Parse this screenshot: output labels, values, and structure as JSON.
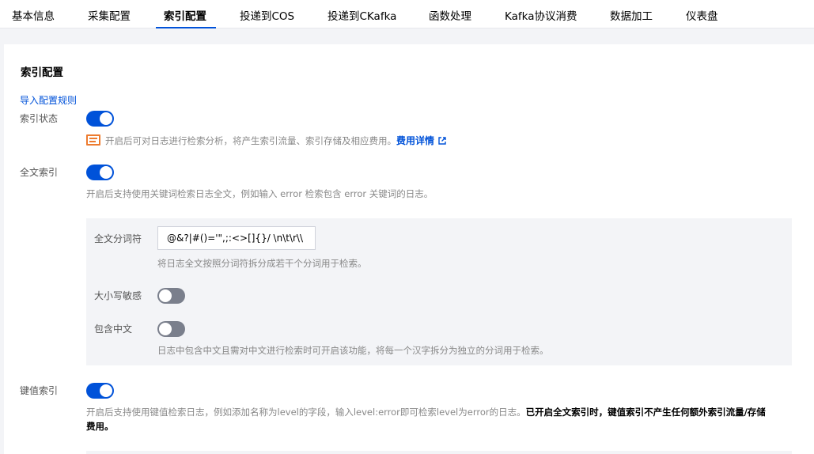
{
  "tabs": [
    {
      "label": "基本信息",
      "active": false
    },
    {
      "label": "采集配置",
      "active": false
    },
    {
      "label": "索引配置",
      "active": true
    },
    {
      "label": "投递到COS",
      "active": false
    },
    {
      "label": "投递到CKafka",
      "active": false
    },
    {
      "label": "函数处理",
      "active": false
    },
    {
      "label": "Kafka协议消费",
      "active": false
    },
    {
      "label": "数据加工",
      "active": false
    },
    {
      "label": "仪表盘",
      "active": false
    }
  ],
  "page": {
    "title": "索引配置",
    "import_rules_link": "导入配置规则"
  },
  "index_status": {
    "label": "索引状态",
    "enabled": true,
    "desc": "开启后可对日志进行检索分析，将产生索引流量、索引存储及相应费用。",
    "fee_link": "费用详情"
  },
  "fulltext_index": {
    "label": "全文索引",
    "enabled": true,
    "desc": "开启后支持使用关键词检索日志全文，例如输入 error 检索包含 error 关键词的日志。",
    "tokenizer": {
      "label": "全文分词符",
      "value": "@&?|#()='\",;:<>[]{}/ \\n\\t\\r\\\\",
      "desc": "将日志全文按照分词符拆分成若干个分词用于检索。"
    },
    "case_sensitive": {
      "label": "大小写敏感",
      "enabled": false
    },
    "include_chinese": {
      "label": "包含中文",
      "enabled": false,
      "desc": "日志中包含中文且需对中文进行检索时可开启该功能，将每一个汉字拆分为独立的分词用于检索。"
    }
  },
  "kv_index": {
    "label": "键值索引",
    "enabled": true,
    "desc": "开启后支持使用键值检索日志，例如添加名称为level的字段，输入level:error即可检索level为error的日志。",
    "desc_strong_line1": "已开启全文索引时，键值索引不产生任何额外索引流量/存储",
    "desc_strong_line2": "费用。"
  },
  "colors": {
    "primary": "#0052d9",
    "toggle_off": "#7a7f8c",
    "warning": "#ed7b2f"
  },
  "icons": {
    "billing": "billing-icon",
    "external_link": "external-link-icon"
  }
}
